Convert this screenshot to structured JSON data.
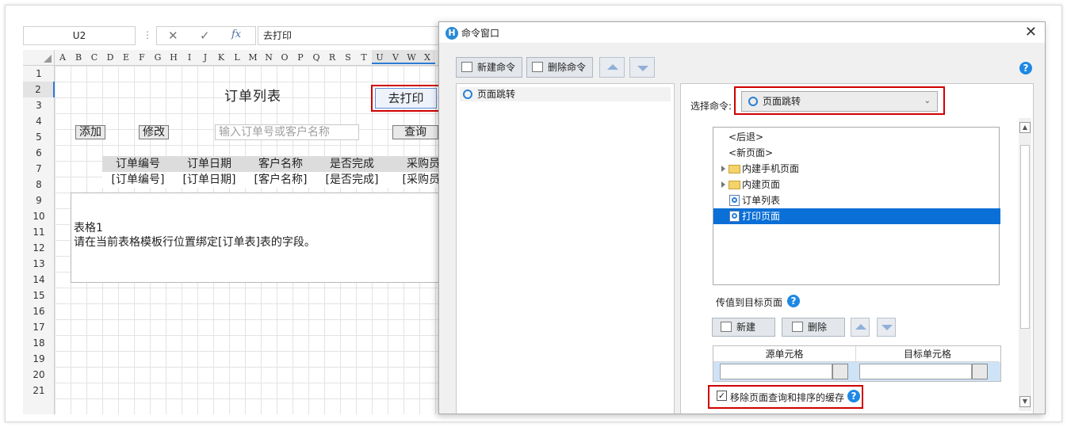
{
  "formula_bar": {
    "cell_ref": "U2",
    "separator": "⋮",
    "cancel_icon": "✕",
    "confirm_icon": "✓",
    "fx_icon": "fx",
    "value": "去打印"
  },
  "sheet": {
    "columns": [
      "A",
      "B",
      "C",
      "D",
      "E",
      "F",
      "G",
      "H",
      "I",
      "J",
      "K",
      "L",
      "M",
      "N",
      "O",
      "P",
      "Q",
      "R",
      "S",
      "T",
      "U",
      "V",
      "W",
      "X"
    ],
    "rows": [
      "1",
      "2",
      "3",
      "4",
      "5",
      "6",
      "7",
      "8",
      "9",
      "10",
      "11",
      "12",
      "13",
      "14",
      "15",
      "16",
      "17",
      "18",
      "19",
      "20",
      "21"
    ],
    "title": "订单列表",
    "print_button": "去打印",
    "add_button": "添加",
    "edit_button": "修改",
    "search_placeholder": "输入订单号或客户名称",
    "query_button": "查询",
    "table_headers": [
      "订单编号",
      "订单日期",
      "客户名称",
      "是否完成",
      "采购员"
    ],
    "table_bindings": [
      "[订单编号]",
      "[订单日期]",
      "[客户名称]",
      "[是否完成]",
      "[采购员]"
    ],
    "table_name": "表格1",
    "table_hint": "请在当前表格模板行位置绑定[订单表]表的字段。"
  },
  "dialog": {
    "title": "命令窗口",
    "close_icon": "✕",
    "new_command": "新建命令",
    "delete_command": "删除命令",
    "command_list": [
      "页面跳转"
    ],
    "select_label": "选择命令:",
    "selected_command": "页面跳转",
    "dropdown_icon": "⌄",
    "tree": {
      "back": "<后退>",
      "new_page": "<新页面>",
      "mobile_pages": "内建手机页面",
      "builtin_pages": "内建页面",
      "order_list": "订单列表",
      "print_page": "打印页面"
    },
    "pass_value_label": "传值到目标页面",
    "help_icon": "?",
    "new_button": "新建",
    "delete_button": "删除",
    "source_cell": "源单元格",
    "target_cell": "目标单元格",
    "clear_cache_label": "移除页面查询和排序的缓存",
    "clear_cache_checked": "✓"
  },
  "colors": {
    "highlight_red": "#d00000",
    "selection_blue": "#0a6fd6",
    "help_blue": "#1e88e5"
  }
}
